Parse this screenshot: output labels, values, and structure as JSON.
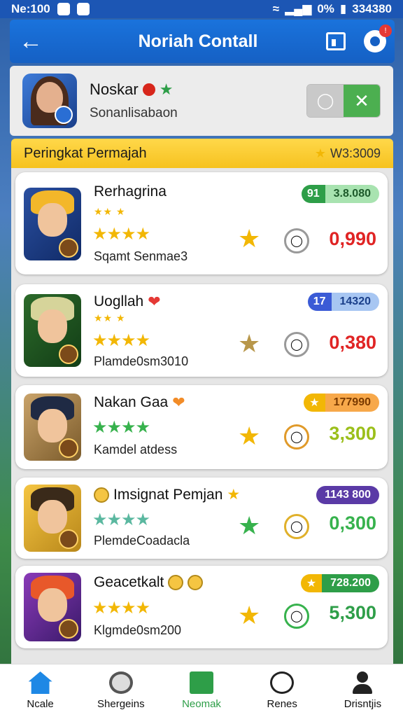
{
  "status_bar": {
    "left_text": "Ne:100",
    "right_text": "0%",
    "right_number": "334380"
  },
  "app_bar": {
    "title": "Noriah Contall",
    "notification_count": "!"
  },
  "profile": {
    "name": "Noskar",
    "subtitle": "Sonanlisabaon"
  },
  "section": {
    "title": "Peringkat Permajah",
    "right_value": "W3:3009"
  },
  "cards": [
    {
      "name": "Rerhagrina",
      "desc": "Sqamt Senmae3",
      "pill_left": "91",
      "pill_right": "3.8.080",
      "score": "0,990",
      "score_color": "#e02424",
      "pill_left_color": "#2e9e48",
      "pill_right_color": "#a8e3b0",
      "stars": "★★★★",
      "star_color": "#f2b705"
    },
    {
      "name": "Uogllah",
      "desc": "Plamde0sm3010",
      "pill_left": "17",
      "pill_right": "14320",
      "score": "0,380",
      "score_color": "#e02424",
      "pill_left_color": "#3b5bd6",
      "pill_right_color": "#a7c6f2",
      "stars": "★★★★",
      "star_color": "#f2b705"
    },
    {
      "name": "Nakan Gaa",
      "desc": "Kamdel atdess",
      "pill_left": "",
      "pill_right": "177990",
      "score": "3,300",
      "score_color": "#9bbf1a",
      "pill_left_color": "#f2b705",
      "pill_right_color": "#f7a84a",
      "stars": "★★★★",
      "star_color": "#37b24d"
    },
    {
      "name": "Imsignat Pemjan",
      "desc": "PlemdeCoadacla",
      "pill_left": "",
      "pill_right": "1143 800",
      "score": "0,300",
      "score_color": "#37b24d",
      "pill_left_color": "#5a3aa6",
      "pill_right_color": "#5a3aa6",
      "stars": "★★★★",
      "star_color": "#5bb8a0"
    },
    {
      "name": "Geacetkalt",
      "desc": "Klgmde0sm200",
      "pill_left": "",
      "pill_right": "728.200",
      "score": "5,300",
      "score_color": "#2e9e48",
      "pill_left_color": "#f2b705",
      "pill_right_color": "#2e9e48",
      "stars": "★★★★",
      "star_color": "#f2b705"
    }
  ],
  "nav": [
    {
      "label": "Ncale"
    },
    {
      "label": "Shergeins"
    },
    {
      "label": "Neomak"
    },
    {
      "label": "Renes"
    },
    {
      "label": "Drisntjis"
    }
  ]
}
